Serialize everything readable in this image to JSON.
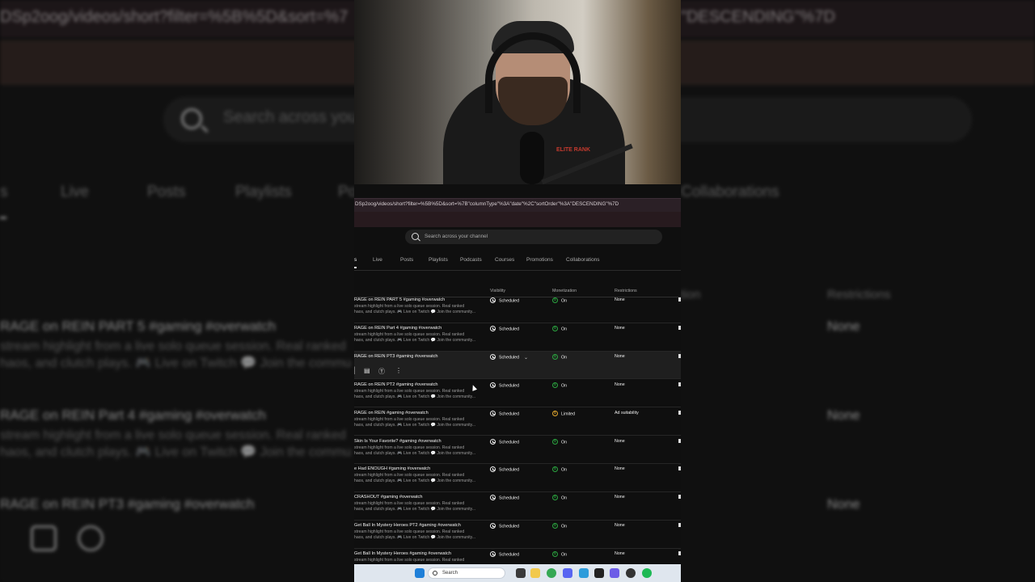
{
  "browser": {
    "url_text": "DSp2oog/videos/short?filter=%5B%5D&sort=%7B\"columnType\"%3A\"date\"%2C\"sortOrder\"%3A\"DESCENDING\"%7D",
    "bg_url_left": "DSp2oog/videos/short?filter=%5B%5D&sort=%7",
    "bg_url_right": "\"DESCENDING\"%7D"
  },
  "search": {
    "placeholder": "Search across your channel",
    "bg_placeholder": "Search across you"
  },
  "tabs": [
    {
      "label": "s"
    },
    {
      "label": "Live"
    },
    {
      "label": "Posts"
    },
    {
      "label": "Playlists"
    },
    {
      "label": "Podcasts"
    },
    {
      "label": "Courses"
    },
    {
      "label": "Promotions"
    },
    {
      "label": "Collaborations"
    }
  ],
  "bg_tabs": [
    "s",
    "Live",
    "Posts",
    "Playlists",
    "Po",
    "Collaborations"
  ],
  "columns": {
    "visibility": "Visibility",
    "monetization": "Monetization",
    "restrictions": "Restrictions",
    "bg_partial_a": "tion",
    "bg_restrictions": "Restrictions"
  },
  "rows": [
    {
      "title": "RAGE on REIN PART 5 #gaming #overwatch",
      "desc1": "stream highlight from a live solo queue session. Real ranked",
      "desc2": "haos, and clutch plays. 🎮 Live on Twitch 💬 Join the community...",
      "visibility": "Scheduled",
      "monetization": "On",
      "restrictions": "None"
    },
    {
      "title": "RAGE on REIN Part 4 #gaming #overwatch",
      "desc1": "stream highlight from a live solo queue session. Real ranked",
      "desc2": "haos, and clutch plays. 🎮 Live on Twitch 💬 Join the community...",
      "visibility": "Scheduled",
      "monetization": "On",
      "restrictions": "None"
    },
    {
      "title": "RAGE on REIN PT3 #gaming #overwatch",
      "desc1": "",
      "desc2": "",
      "visibility": "Scheduled",
      "monetization": "On",
      "restrictions": "None"
    },
    {
      "title": "RAGE on REIN PT2 #gaming #overwatch",
      "desc1": "stream highlight from a live solo queue session. Real ranked",
      "desc2": "haos, and clutch plays. 🎮 Live on Twitch 💬 Join the community...",
      "visibility": "Scheduled",
      "monetization": "On",
      "restrictions": "None"
    },
    {
      "title": "RAGE on REIN #gaming #overwatch",
      "desc1": "stream highlight from a live solo queue session. Real ranked",
      "desc2": "haos, and clutch plays. 🎮 Live on Twitch 💬 Join the community...",
      "visibility": "Scheduled",
      "monetization": "Limited",
      "restrictions": "Ad suitability"
    },
    {
      "title": "Skin Is Your Favorite? #gaming #overwatch",
      "desc1": "stream highlight from a live solo queue session. Real ranked",
      "desc2": "haos, and clutch plays. 🎮 Live on Twitch 💬 Join the community...",
      "visibility": "Scheduled",
      "monetization": "On",
      "restrictions": "None"
    },
    {
      "title": "e Had ENOUGH #gaming #overwatch",
      "desc1": "stream highlight from a live solo queue session. Real ranked",
      "desc2": "haos, and clutch plays. 🎮 Live on Twitch 💬 Join the community...",
      "visibility": "Scheduled",
      "monetization": "On",
      "restrictions": "None"
    },
    {
      "title": "CRASHOUT #gaming #overwatch",
      "desc1": "stream highlight from a live solo queue session. Real ranked",
      "desc2": "haos, and clutch plays. 🎮 Live on Twitch 💬 Join the community...",
      "visibility": "Scheduled",
      "monetization": "On",
      "restrictions": "None"
    },
    {
      "title": "Get Ball In Mystery Heroes PT2 #gaming #overwatch",
      "desc1": "stream highlight from a live solo queue session. Real ranked",
      "desc2": "haos, and clutch plays. 🎮 Live on Twitch 💬 Join the community...",
      "visibility": "Scheduled",
      "monetization": "On",
      "restrictions": "None"
    },
    {
      "title": "Get Ball In Mystery Heroes #gaming #overwatch",
      "desc1": "stream highlight from a live solo queue session. Real ranked",
      "desc2": "",
      "visibility": "Scheduled",
      "monetization": "On",
      "restrictions": "None"
    }
  ],
  "bg_rows": {
    "r1_title": "RAGE on REIN PART 5 #gaming #overwatch",
    "r1_desc1": "stream highlight from a live solo queue session. Real ranked",
    "r1_desc2": "haos, and clutch plays. 🎮 Live on Twitch 💬 Join the commu",
    "r2_title": "RAGE on REIN Part 4 #gaming #overwatch",
    "r2_desc1": "stream highlight from a live solo queue session. Real ranked",
    "r2_desc2": "haos, and clutch plays. 🎮 Live on Twitch 💬 Join the commu",
    "r3_title": "RAGE on REIN PT3 #gaming #overwatch",
    "none": "None"
  },
  "taskbar": {
    "search_label": "Search"
  },
  "webcam": {
    "shirt_text": "ELITE RANK"
  },
  "colors": {
    "monetization_on": "#2ba640",
    "monetization_limited": "#e2a72e",
    "taskbar_bg": "#dfe6ee"
  }
}
